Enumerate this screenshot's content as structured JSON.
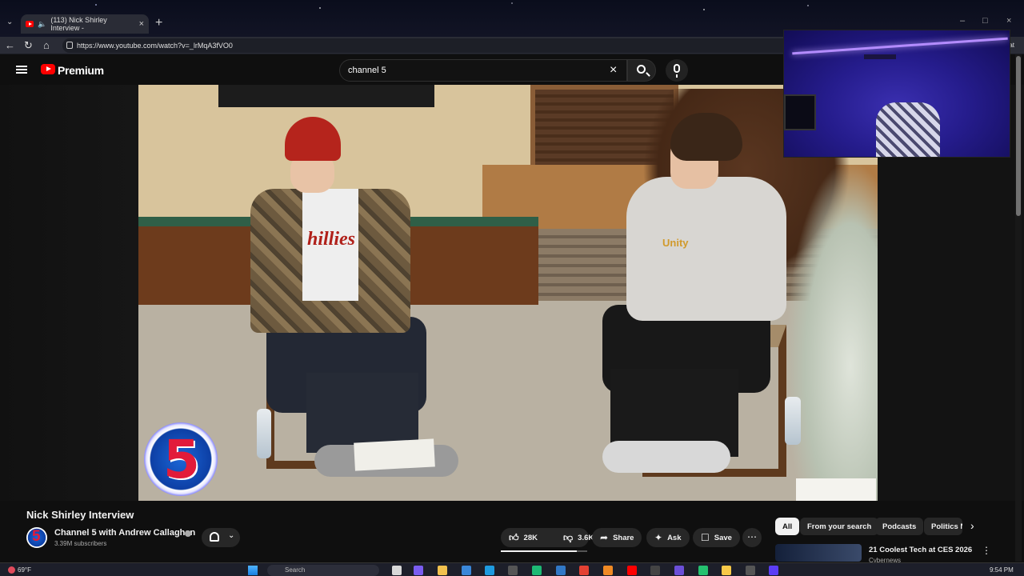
{
  "browser": {
    "tab_title": "(113) Nick Shirley Interview -",
    "url": "https://www.youtube.com/watch?v=_lrMqA3fVO0",
    "extra_text": "hat"
  },
  "youtube": {
    "brand": "Premium",
    "search_value": "channel 5"
  },
  "video": {
    "title": "Nick Shirley Interview",
    "overlay_logo_text": "5",
    "shirt_text": "hillies",
    "hoodie_text": "Unity"
  },
  "channel": {
    "avatar_text": "5",
    "name": "Channel 5 with Andrew Callaghan",
    "subscribers": "3.39M subscribers"
  },
  "actions": {
    "likes": "28K",
    "dislikes": "3.6K",
    "share": "Share",
    "ask": "Ask",
    "save": "Save",
    "like_ratio": 0.88
  },
  "chips": [
    "All",
    "From your search",
    "Podcasts",
    "Politics N"
  ],
  "recommendation": {
    "title": "21 Coolest Tech at CES 2026",
    "sub": "Cybernews"
  },
  "taskbar": {
    "weather": "69°F",
    "search_placeholder": "Search",
    "time": "9:54 PM"
  },
  "colors": {
    "youtube_red": "#ff0000",
    "background": "#0f0f0f",
    "chip_active": "#f1f1f1"
  }
}
